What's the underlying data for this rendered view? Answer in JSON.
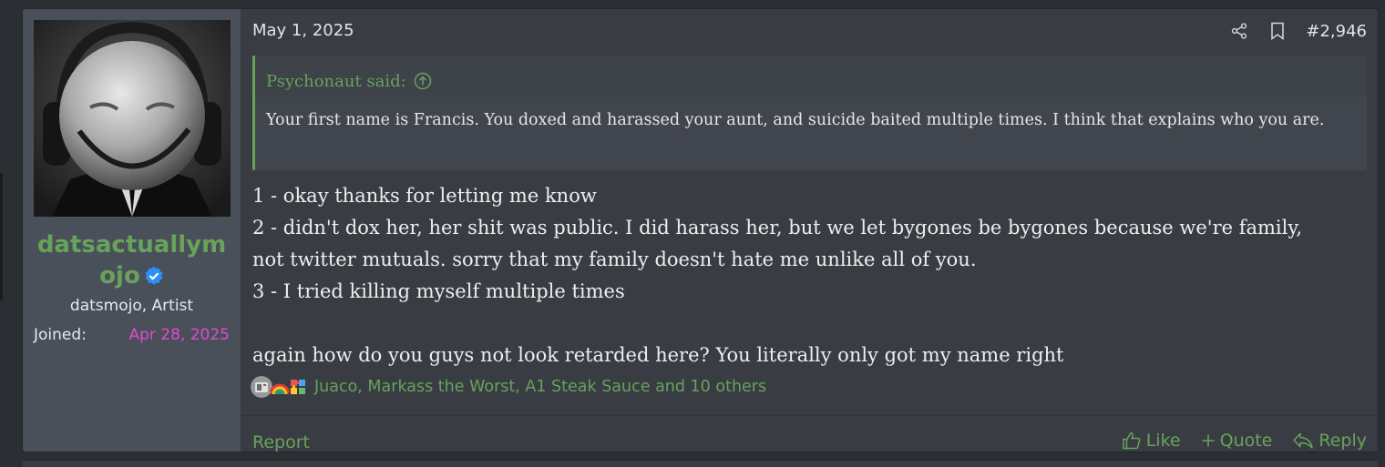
{
  "colors": {
    "accent": "#67a35a",
    "joined_date": "#e04ad1",
    "verified": "#2f8ff5"
  },
  "user": {
    "username": "datsactuallymojo",
    "title": "datsmojo, Artist",
    "joined_label": "Joined:",
    "joined_date": "Apr 28, 2025",
    "verified_icon": "verified-badge-icon"
  },
  "post": {
    "date": "May 1, 2025",
    "number": "#2,946",
    "share_icon": "share-icon",
    "bookmark_icon": "bookmark-icon",
    "quote": {
      "author_said": "Psychonaut said:",
      "body": "Your first name is Francis. You doxed and harassed your aunt, and suicide baited multiple times. I think that explains who you are."
    },
    "body_lines": [
      "1 - okay thanks for letting me know",
      "2 - didn't dox her, her shit was public. I did harass her, but we let bygones be bygones because we're family,",
      "not twitter mutuals. sorry that my family doesn't hate me unlike all of you.",
      "3 - I tried killing myself multiple times",
      "",
      "again how do you guys not look retarded here? You literally only got my name right"
    ],
    "reactions_text": "Juaco, Markass the Worst, A1 Steak Sauce and 10 others"
  },
  "footer": {
    "report": "Report",
    "like": "Like",
    "quote": "Quote",
    "reply": "Reply"
  }
}
